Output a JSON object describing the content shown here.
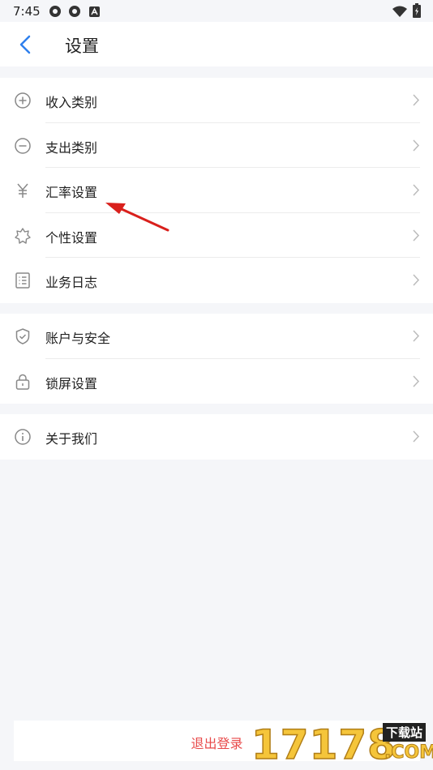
{
  "status_bar": {
    "time": "7:45"
  },
  "header": {
    "title": "设置"
  },
  "groups": [
    [
      {
        "label": "收入类别",
        "icon": "plus-circle-icon"
      },
      {
        "label": "支出类别",
        "icon": "minus-circle-icon"
      },
      {
        "label": "汇率设置",
        "icon": "yen-icon"
      },
      {
        "label": "个性设置",
        "icon": "badge-icon"
      },
      {
        "label": "业务日志",
        "icon": "list-icon"
      }
    ],
    [
      {
        "label": "账户与安全",
        "icon": "shield-icon"
      },
      {
        "label": "锁屏设置",
        "icon": "lock-icon"
      }
    ],
    [
      {
        "label": "关于我们",
        "icon": "info-icon"
      }
    ]
  ],
  "logout": {
    "label": "退出登录",
    "color": "#e84a4a"
  },
  "watermark": {
    "digits": "17178",
    "tag": "下载站",
    "com": ".COM"
  },
  "colors": {
    "accent": "#2f80ed",
    "annotation_arrow": "#d9201c"
  }
}
